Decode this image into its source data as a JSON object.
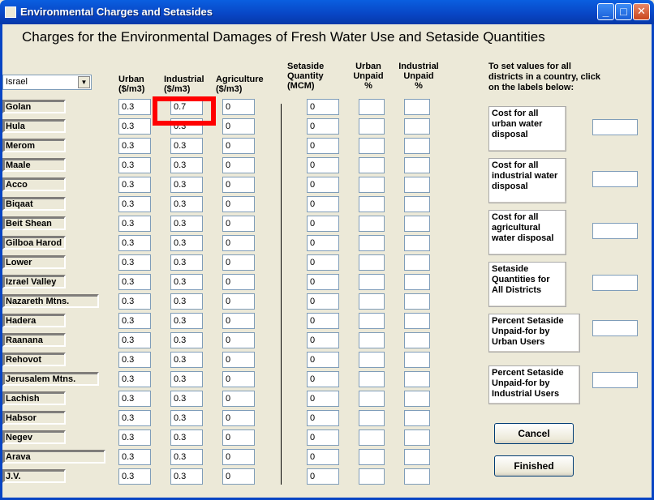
{
  "window": {
    "title": "Environmental Charges and Setasides",
    "minimize": "_",
    "maximize": "□",
    "close": "✕"
  },
  "heading": "Charges for the Environmental Damages of Fresh Water Use and Setaside Quantities",
  "country_select": {
    "value": "Israel"
  },
  "columns": {
    "urban": [
      "Urban",
      "($/m3)"
    ],
    "industrial": [
      "Industrial",
      "($/m3)"
    ],
    "agriculture": [
      "Agriculture",
      "($/m3)"
    ],
    "setaside": [
      "Setaside",
      "Quantity",
      "(MCM)"
    ],
    "urban_unpaid": [
      "Urban",
      "Unpaid",
      "%"
    ],
    "industrial_unpaid": [
      "Industrial",
      "Unpaid",
      "%"
    ]
  },
  "rows": [
    {
      "district": "Golan",
      "urban": "0.3",
      "industrial": "0.7",
      "agriculture": "0",
      "setaside": "0"
    },
    {
      "district": "Hula",
      "urban": "0.3",
      "industrial": "0.3",
      "agriculture": "0",
      "setaside": "0"
    },
    {
      "district": "Merom",
      "urban": "0.3",
      "industrial": "0.3",
      "agriculture": "0",
      "setaside": "0"
    },
    {
      "district": "Maale",
      "urban": "0.3",
      "industrial": "0.3",
      "agriculture": "0",
      "setaside": "0"
    },
    {
      "district": "Acco",
      "urban": "0.3",
      "industrial": "0.3",
      "agriculture": "0",
      "setaside": "0"
    },
    {
      "district": "Biqaat",
      "urban": "0.3",
      "industrial": "0.3",
      "agriculture": "0",
      "setaside": "0"
    },
    {
      "district": "Beit Shean",
      "urban": "0.3",
      "industrial": "0.3",
      "agriculture": "0",
      "setaside": "0"
    },
    {
      "district": "Gilboa Harod",
      "urban": "0.3",
      "industrial": "0.3",
      "agriculture": "0",
      "setaside": "0"
    },
    {
      "district": "Lower",
      "urban": "0.3",
      "industrial": "0.3",
      "agriculture": "0",
      "setaside": "0"
    },
    {
      "district": "Izrael Valley",
      "urban": "0.3",
      "industrial": "0.3",
      "agriculture": "0",
      "setaside": "0"
    },
    {
      "district": "Nazareth Mtns.",
      "urban": "0.3",
      "industrial": "0.3",
      "agriculture": "0",
      "setaside": "0"
    },
    {
      "district": "Hadera",
      "urban": "0.3",
      "industrial": "0.3",
      "agriculture": "0",
      "setaside": "0"
    },
    {
      "district": "Raanana",
      "urban": "0.3",
      "industrial": "0.3",
      "agriculture": "0",
      "setaside": "0"
    },
    {
      "district": "Rehovot",
      "urban": "0.3",
      "industrial": "0.3",
      "agriculture": "0",
      "setaside": "0"
    },
    {
      "district": "Jerusalem Mtns.",
      "urban": "0.3",
      "industrial": "0.3",
      "agriculture": "0",
      "setaside": "0"
    },
    {
      "district": "Lachish",
      "urban": "0.3",
      "industrial": "0.3",
      "agriculture": "0",
      "setaside": "0"
    },
    {
      "district": "Habsor",
      "urban": "0.3",
      "industrial": "0.3",
      "agriculture": "0",
      "setaside": "0"
    },
    {
      "district": "Negev",
      "urban": "0.3",
      "industrial": "0.3",
      "agriculture": "0",
      "setaside": "0"
    },
    {
      "district": "Arava",
      "urban": "0.3",
      "industrial": "0.3",
      "agriculture": "0",
      "setaside": "0"
    },
    {
      "district": "J.V.",
      "urban": "0.3",
      "industrial": "0.3",
      "agriculture": "0",
      "setaside": "0"
    }
  ],
  "side_panel": {
    "instructions": [
      "To set values for all",
      "districts in a country, click",
      "on the labels below:"
    ],
    "labels": [
      [
        "Cost for all",
        "urban water",
        "disposal"
      ],
      [
        "Cost for all",
        "industrial water",
        "disposal"
      ],
      [
        "Cost for all",
        "agricultural",
        "water disposal"
      ],
      [
        "Setaside",
        "Quantities for",
        "All Districts"
      ],
      [
        "Percent Setaside",
        "Unpaid-for by",
        "Urban Users"
      ],
      [
        "Percent Setaside",
        "Unpaid-for by",
        "Industrial Users"
      ]
    ]
  },
  "buttons": {
    "cancel": "Cancel",
    "finished": "Finished"
  },
  "colors": {
    "highlight": "#ff0000",
    "titlebar": "#0845c4",
    "background": "#ece9d8"
  }
}
